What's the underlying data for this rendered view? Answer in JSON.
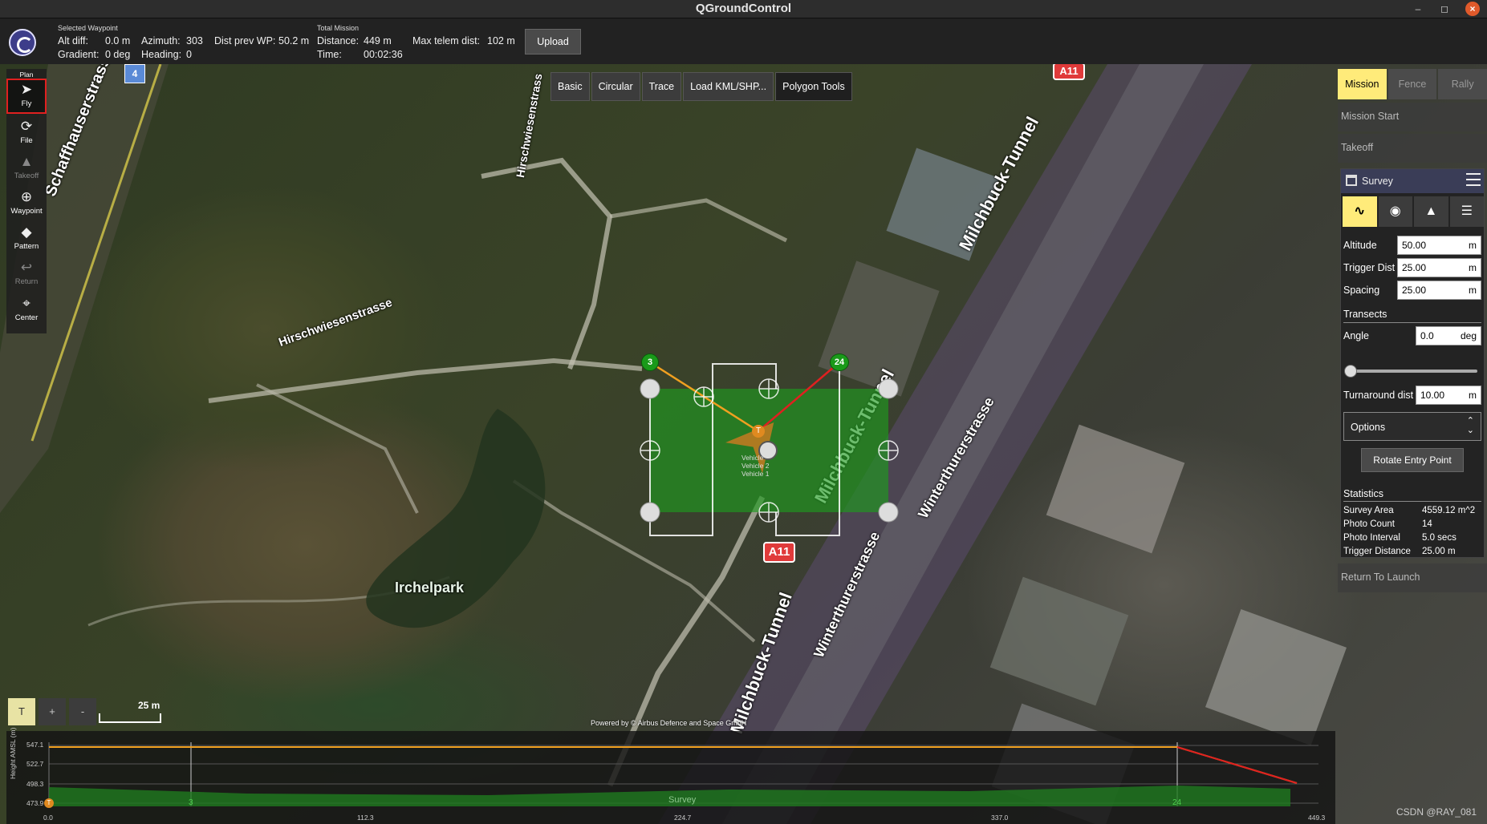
{
  "window": {
    "title": "QGroundControl",
    "min_icon": "minimize-icon",
    "max_icon": "maximize-icon",
    "close_icon": "close-icon"
  },
  "toolbar": {
    "selected_waypoint_heading": "Selected Waypoint",
    "alt_diff_label": "Alt diff:",
    "alt_diff_value": "0.0 m",
    "gradient_label": "Gradient:",
    "gradient_value": "0 deg",
    "azimuth_label": "Azimuth:",
    "azimuth_value": "303",
    "heading_label": "Heading:",
    "heading_value": "0",
    "dist_prev_label": "Dist prev WP:",
    "dist_prev_value": "50.2 m",
    "total_mission_heading": "Total Mission",
    "distance_label": "Distance:",
    "distance_value": "449 m",
    "time_label": "Time:",
    "time_value": "00:02:36",
    "max_telem_label": "Max telem dist:",
    "max_telem_value": "102 m",
    "upload_label": "Upload"
  },
  "plan_tools": [
    {
      "label": "Plan",
      "icon": "plan-label"
    },
    {
      "label": "Fly",
      "icon": "paper-plane-icon"
    },
    {
      "label": "File",
      "icon": "file-icon"
    },
    {
      "label": "Takeoff",
      "icon": "takeoff-icon"
    },
    {
      "label": "Waypoint",
      "icon": "waypoint-icon"
    },
    {
      "label": "Pattern",
      "icon": "pattern-icon"
    },
    {
      "label": "Return",
      "icon": "return-icon"
    },
    {
      "label": "Center",
      "icon": "center-icon"
    }
  ],
  "pattern_tools": [
    "Basic",
    "Circular",
    "Trace",
    "Load KML/SHP...",
    "Polygon Tools"
  ],
  "right_panel": {
    "tabs": [
      "Mission",
      "Fence",
      "Rally"
    ],
    "mission_start": "Mission Start",
    "takeoff": "Takeoff",
    "return_to_launch": "Return To Launch",
    "survey": {
      "title": "Survey",
      "altitude_label": "Altitude",
      "altitude_value": "50.00",
      "altitude_unit": "m",
      "trigger_label": "Trigger Dist",
      "trigger_value": "25.00",
      "trigger_unit": "m",
      "spacing_label": "Spacing",
      "spacing_value": "25.00",
      "spacing_unit": "m",
      "transects_label": "Transects",
      "angle_label": "Angle",
      "angle_value": "0.0",
      "angle_unit": "deg",
      "turnaround_label": "Turnaround dist",
      "turnaround_value": "10.00",
      "turnaround_unit": "m",
      "options_label": "Options",
      "rotate_label": "Rotate Entry Point",
      "statistics_label": "Statistics",
      "stats": [
        {
          "label": "Survey Area",
          "value": "4559.12 m^2"
        },
        {
          "label": "Photo Count",
          "value": "14"
        },
        {
          "label": "Photo Interval",
          "value": "5.0 secs"
        },
        {
          "label": "Trigger Distance",
          "value": "25.00 m"
        }
      ]
    }
  },
  "map": {
    "labels": {
      "schaffhauserstrasse": "Schaffhauserstrasse",
      "hirschwiesenstrasse": "Hirschwiesenstrasse",
      "hirschwiesenstrass_vertical": "Hirschwiesenstrass",
      "milchbuck_tunnel_1": "Milchbuck-Tunnel",
      "milchbuck_tunnel_2": "Milchbuck-Tunnel",
      "milchbuck_tunnel_3": "Milchbuck-Tunnel",
      "winterthurerstrasse_1": "Winterthurerstrasse",
      "winterthurerstrasse_2": "Winterthurerstrasse",
      "irchelpark": "Irchelpark",
      "a11_top": "A11",
      "a11_center": "A11",
      "route_4": "4",
      "wp_3": "3",
      "wp_24": "24",
      "takeoff_marker": "T",
      "vehicle_label_1": "Vehicle",
      "vehicle_label_2": "Vehicle 2",
      "vehicle_label_3": "Vehicle 1"
    },
    "controls": {
      "t_label": "T",
      "zoom_in": "+",
      "zoom_out": "-"
    },
    "scale_label": "25 m",
    "attribution": "Powered by © Airbus Defence and Space GmbH"
  },
  "elevation": {
    "y_axis_label": "Height AMSL (m)",
    "y_ticks": [
      "547.1",
      "522.7",
      "498.3",
      "473.9"
    ],
    "x_ticks": [
      "0.0",
      "112.3",
      "224.7",
      "337.0",
      "449.3"
    ],
    "markers": {
      "start": "T",
      "wp_3": "3",
      "survey": "Survey",
      "wp_24": "24"
    }
  },
  "watermark": "CSDN @RAY_081",
  "colors": {
    "accent": "#ffeb7a",
    "survey_fill": "#1f9a1f",
    "path_orange": "#f0a020",
    "path_red": "#e02020",
    "waypoint_green": "#1a9a1a"
  }
}
